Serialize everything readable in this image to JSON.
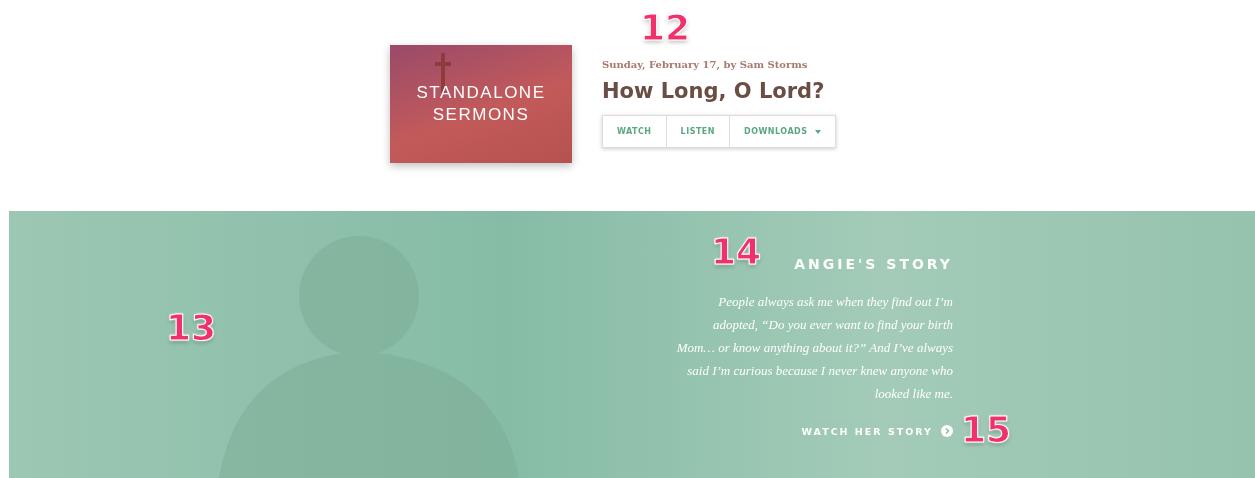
{
  "sermon": {
    "artwork_title": [
      "STANDALONE",
      "SERMONS"
    ],
    "meta": "Sunday, February 17, by Sam Storms",
    "title": "How Long, O Lord?",
    "actions": [
      {
        "label": "WATCH",
        "kind": "plain"
      },
      {
        "label": "LISTEN",
        "kind": "plain"
      },
      {
        "label": "DOWNLOADS",
        "kind": "dropdown"
      }
    ]
  },
  "story": {
    "heading": "ANGIE'S STORY",
    "quote": "People always ask me when they find out I’m adopted, “Do you ever want to find your birth Mom… or know anything about it?” And I’ve always said I’m curious because I never knew anyone who looked like me.",
    "link": "WATCH HER STORY"
  },
  "callouts": {
    "sermon": "12",
    "photo": "13",
    "heading": "14",
    "link": "15"
  }
}
